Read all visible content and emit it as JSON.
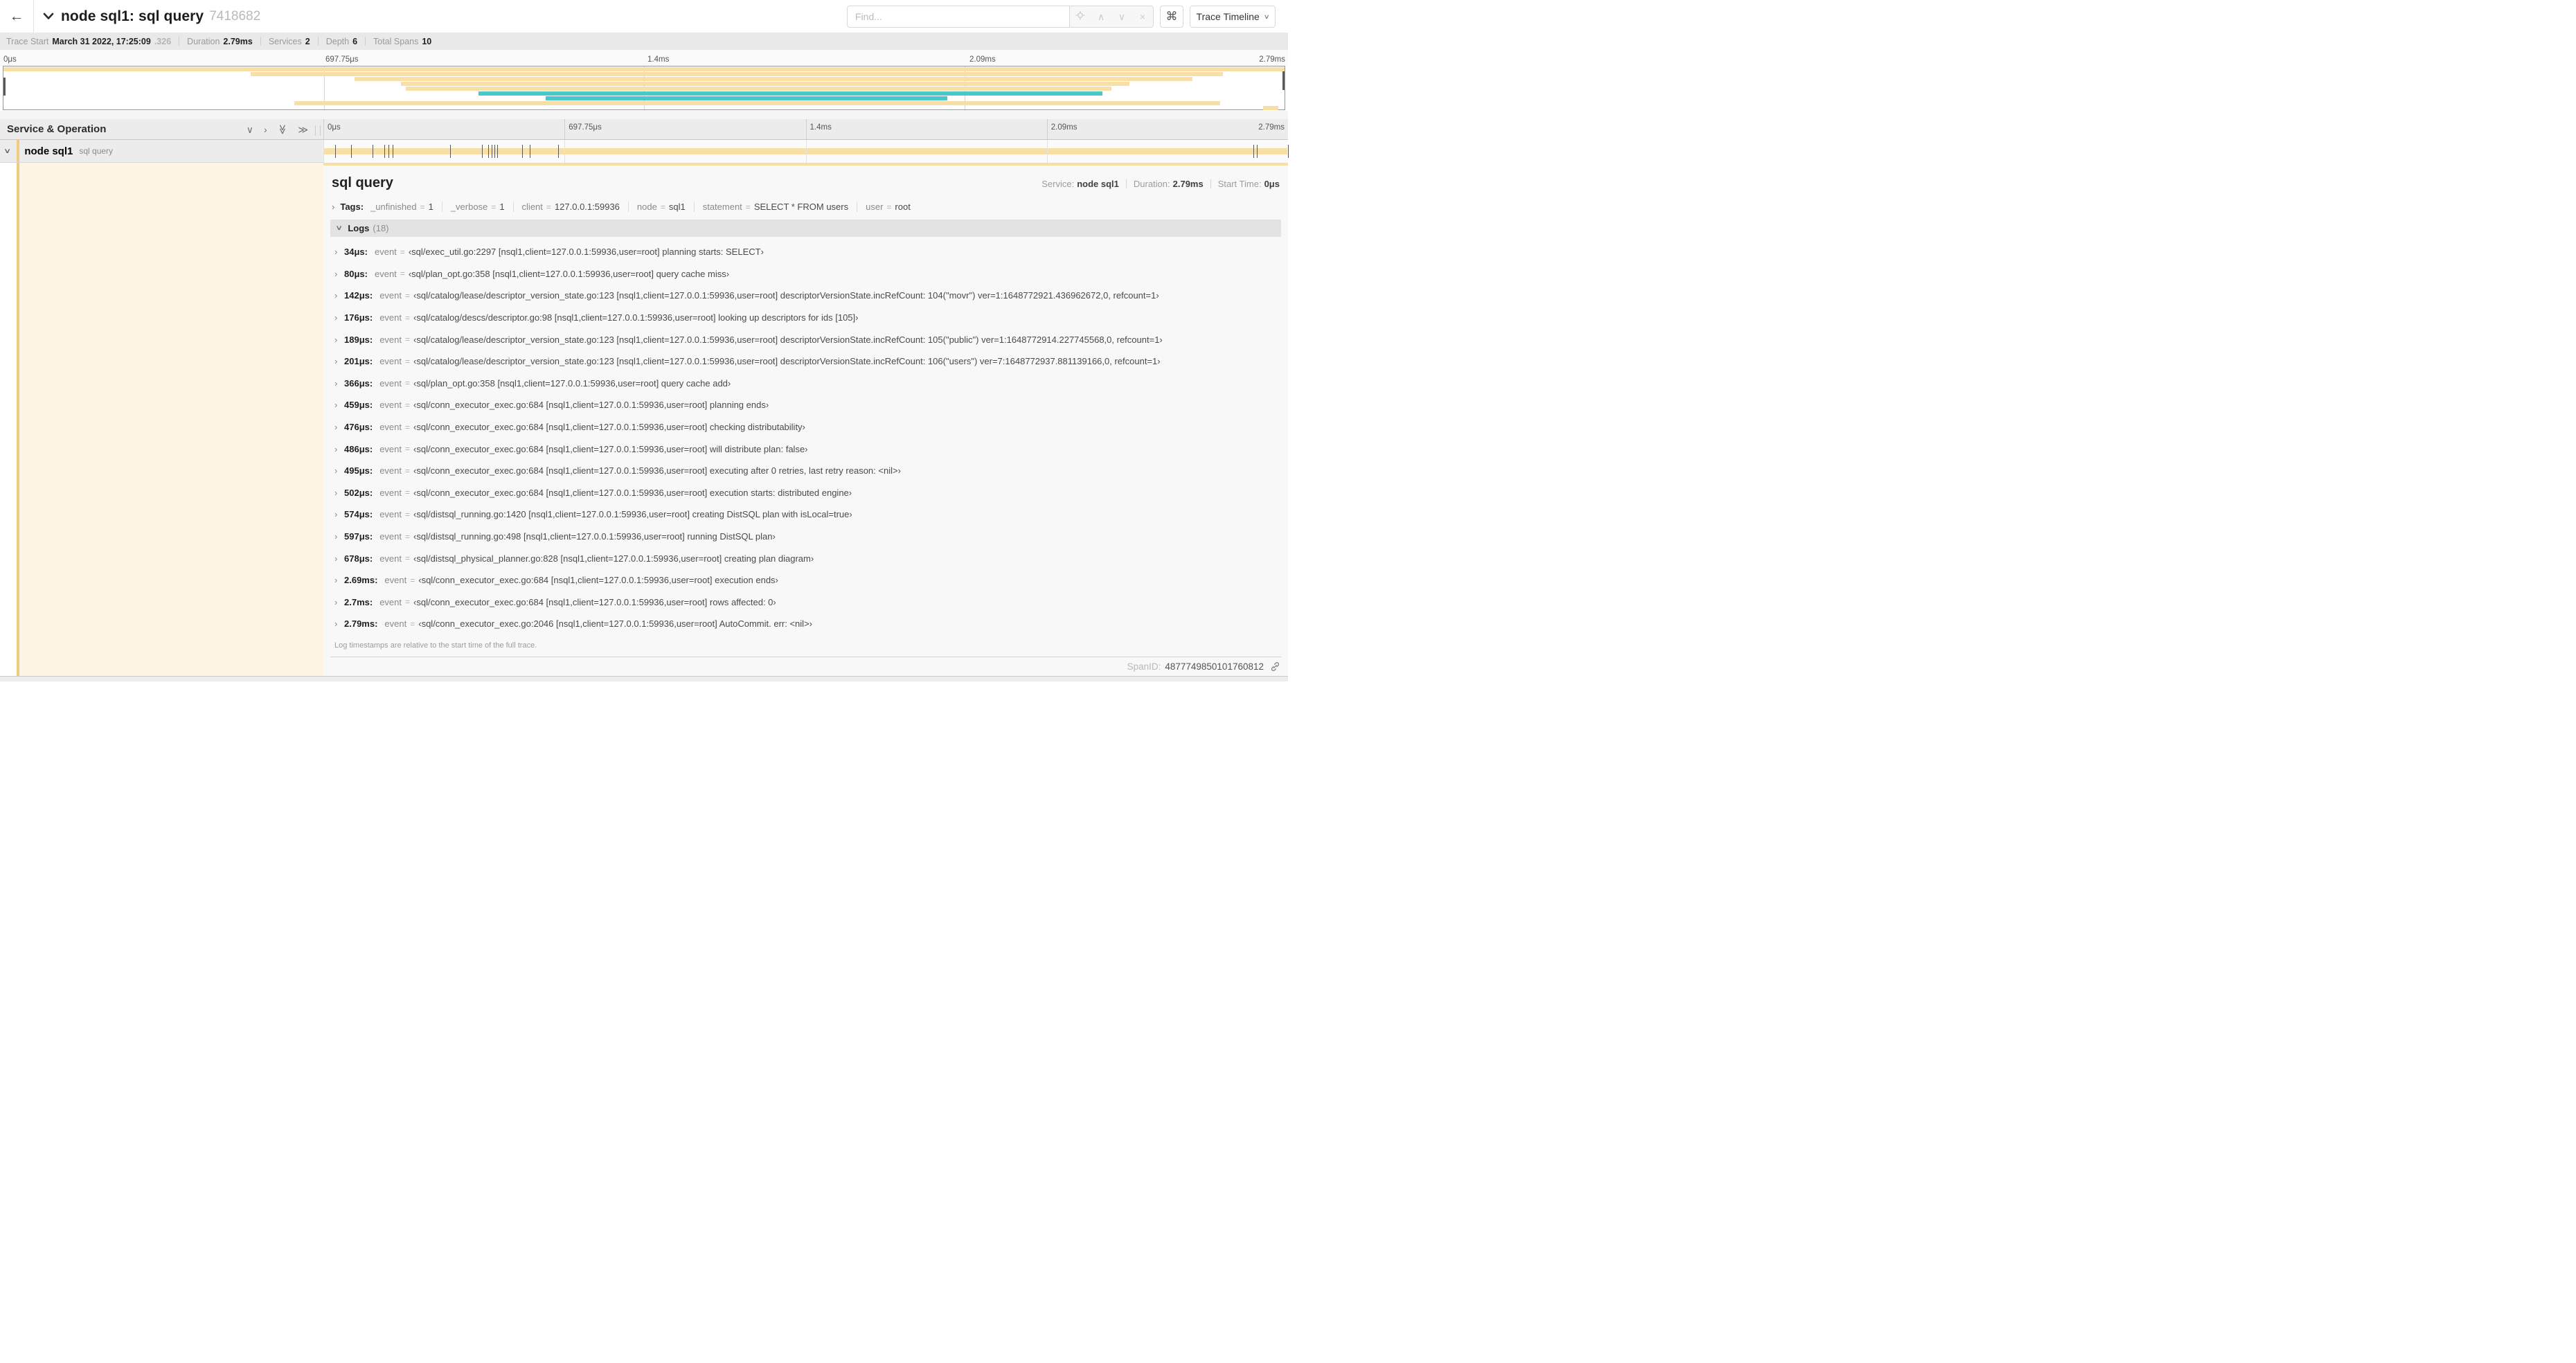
{
  "header": {
    "back_icon": "arrow-left",
    "title": "node sql1: sql query",
    "trace_id": "7418682",
    "find_placeholder": "Find...",
    "shortcut_button": "⌘",
    "view_button": "Trace Timeline"
  },
  "trace_info": {
    "trace_start_label": "Trace Start",
    "trace_start": "March 31 2022, 17:25:09",
    "trace_start_frac": ".326",
    "duration_label": "Duration",
    "duration": "2.79ms",
    "services_label": "Services",
    "services": "2",
    "depth_label": "Depth",
    "depth": "6",
    "total_spans_label": "Total Spans",
    "total_spans": "10"
  },
  "ruler": {
    "ticks": [
      {
        "label": "0μs",
        "pos": 0
      },
      {
        "label": "697.75μs",
        "pos": 25
      },
      {
        "label": "1.4ms",
        "pos": 50
      },
      {
        "label": "2.09ms",
        "pos": 75
      },
      {
        "label": "2.79ms",
        "pos": 100
      }
    ]
  },
  "minimap": {
    "bars": [
      {
        "row": 0,
        "start": 0,
        "width": 100,
        "color": "tan"
      },
      {
        "row": 1,
        "start": 19.3,
        "width": 75.9,
        "color": "tan"
      },
      {
        "row": 2,
        "start": 27.4,
        "width": 65.4,
        "color": "tan"
      },
      {
        "row": 3,
        "start": 31.0,
        "width": 56.9,
        "color": "tan"
      },
      {
        "row": 4,
        "start": 31.4,
        "width": 55.1,
        "color": "tan"
      },
      {
        "row": 5,
        "start": 37.1,
        "width": 48.7,
        "color": "teal"
      },
      {
        "row": 6,
        "start": 42.3,
        "width": 31.4,
        "color": "teal"
      },
      {
        "row": 7,
        "start": 22.7,
        "width": 72.3,
        "color": "tan"
      },
      {
        "row": 8,
        "start": 98.3,
        "width": 1.2,
        "color": "tan"
      }
    ]
  },
  "timeline_header": {
    "label": "Service & Operation"
  },
  "span_row": {
    "service": "node sql1",
    "operation": "sql query",
    "total_us": 2790
  },
  "detail": {
    "title": "sql query",
    "service_label": "Service:",
    "service": "node sql1",
    "duration_label": "Duration:",
    "duration": "2.79ms",
    "start_label": "Start Time:",
    "start": "0μs",
    "tags_label": "Tags:",
    "tags": [
      {
        "key": "_unfinished",
        "value": "1"
      },
      {
        "key": "_verbose",
        "value": "1"
      },
      {
        "key": "client",
        "value": "127.0.0.1:59936"
      },
      {
        "key": "node",
        "value": "sql1"
      },
      {
        "key": "statement",
        "value": "SELECT * FROM users"
      },
      {
        "key": "user",
        "value": "root"
      }
    ],
    "logs_label": "Logs",
    "logs_count": "(18)",
    "logs": [
      {
        "time": "34μs:",
        "us": 34,
        "key": "event",
        "value": "‹sql/exec_util.go:2297 [nsql1,client=127.0.0.1:59936,user=root] planning starts: SELECT›"
      },
      {
        "time": "80μs:",
        "us": 80,
        "key": "event",
        "value": "‹sql/plan_opt.go:358 [nsql1,client=127.0.0.1:59936,user=root] query cache miss›"
      },
      {
        "time": "142μs:",
        "us": 142,
        "key": "event",
        "value": "‹sql/catalog/lease/descriptor_version_state.go:123 [nsql1,client=127.0.0.1:59936,user=root] descriptorVersionState.incRefCount: 104(\"movr\") ver=1:1648772921.436962672,0, refcount=1›"
      },
      {
        "time": "176μs:",
        "us": 176,
        "key": "event",
        "value": "‹sql/catalog/descs/descriptor.go:98 [nsql1,client=127.0.0.1:59936,user=root] looking up descriptors for ids [105]›"
      },
      {
        "time": "189μs:",
        "us": 189,
        "key": "event",
        "value": "‹sql/catalog/lease/descriptor_version_state.go:123 [nsql1,client=127.0.0.1:59936,user=root] descriptorVersionState.incRefCount: 105(\"public\") ver=1:1648772914.227745568,0, refcount=1›"
      },
      {
        "time": "201μs:",
        "us": 201,
        "key": "event",
        "value": "‹sql/catalog/lease/descriptor_version_state.go:123 [nsql1,client=127.0.0.1:59936,user=root] descriptorVersionState.incRefCount: 106(\"users\") ver=7:1648772937.881139166,0, refcount=1›"
      },
      {
        "time": "366μs:",
        "us": 366,
        "key": "event",
        "value": "‹sql/plan_opt.go:358 [nsql1,client=127.0.0.1:59936,user=root] query cache add›"
      },
      {
        "time": "459μs:",
        "us": 459,
        "key": "event",
        "value": "‹sql/conn_executor_exec.go:684 [nsql1,client=127.0.0.1:59936,user=root] planning ends›"
      },
      {
        "time": "476μs:",
        "us": 476,
        "key": "event",
        "value": "‹sql/conn_executor_exec.go:684 [nsql1,client=127.0.0.1:59936,user=root] checking distributability›"
      },
      {
        "time": "486μs:",
        "us": 486,
        "key": "event",
        "value": "‹sql/conn_executor_exec.go:684 [nsql1,client=127.0.0.1:59936,user=root] will distribute plan: false›"
      },
      {
        "time": "495μs:",
        "us": 495,
        "key": "event",
        "value": "‹sql/conn_executor_exec.go:684 [nsql1,client=127.0.0.1:59936,user=root] executing after 0 retries, last retry reason: <nil>›"
      },
      {
        "time": "502μs:",
        "us": 502,
        "key": "event",
        "value": "‹sql/conn_executor_exec.go:684 [nsql1,client=127.0.0.1:59936,user=root] execution starts: distributed engine›"
      },
      {
        "time": "574μs:",
        "us": 574,
        "key": "event",
        "value": "‹sql/distsql_running.go:1420 [nsql1,client=127.0.0.1:59936,user=root] creating DistSQL plan with isLocal=true›"
      },
      {
        "time": "597μs:",
        "us": 597,
        "key": "event",
        "value": "‹sql/distsql_running.go:498 [nsql1,client=127.0.0.1:59936,user=root] running DistSQL plan›"
      },
      {
        "time": "678μs:",
        "us": 678,
        "key": "event",
        "value": "‹sql/distsql_physical_planner.go:828 [nsql1,client=127.0.0.1:59936,user=root] creating plan diagram›"
      },
      {
        "time": "2.69ms:",
        "us": 2690,
        "key": "event",
        "value": "‹sql/conn_executor_exec.go:684 [nsql1,client=127.0.0.1:59936,user=root] execution ends›"
      },
      {
        "time": "2.7ms:",
        "us": 2700,
        "key": "event",
        "value": "‹sql/conn_executor_exec.go:684 [nsql1,client=127.0.0.1:59936,user=root] rows affected: 0›"
      },
      {
        "time": "2.79ms:",
        "us": 2790,
        "key": "event",
        "value": "‹sql/conn_executor_exec.go:2046 [nsql1,client=127.0.0.1:59936,user=root] AutoCommit. err: <nil>›"
      }
    ],
    "note": "Log timestamps are relative to the start time of the full trace.",
    "spanid_label": "SpanID:",
    "spanid": "4877749850101760812"
  },
  "colors": {
    "span_bar_tan": "#f8dfa6",
    "span_accent": "#efcc82",
    "teal": "#49c8cc",
    "selected_cream": "#fdf4e3"
  }
}
